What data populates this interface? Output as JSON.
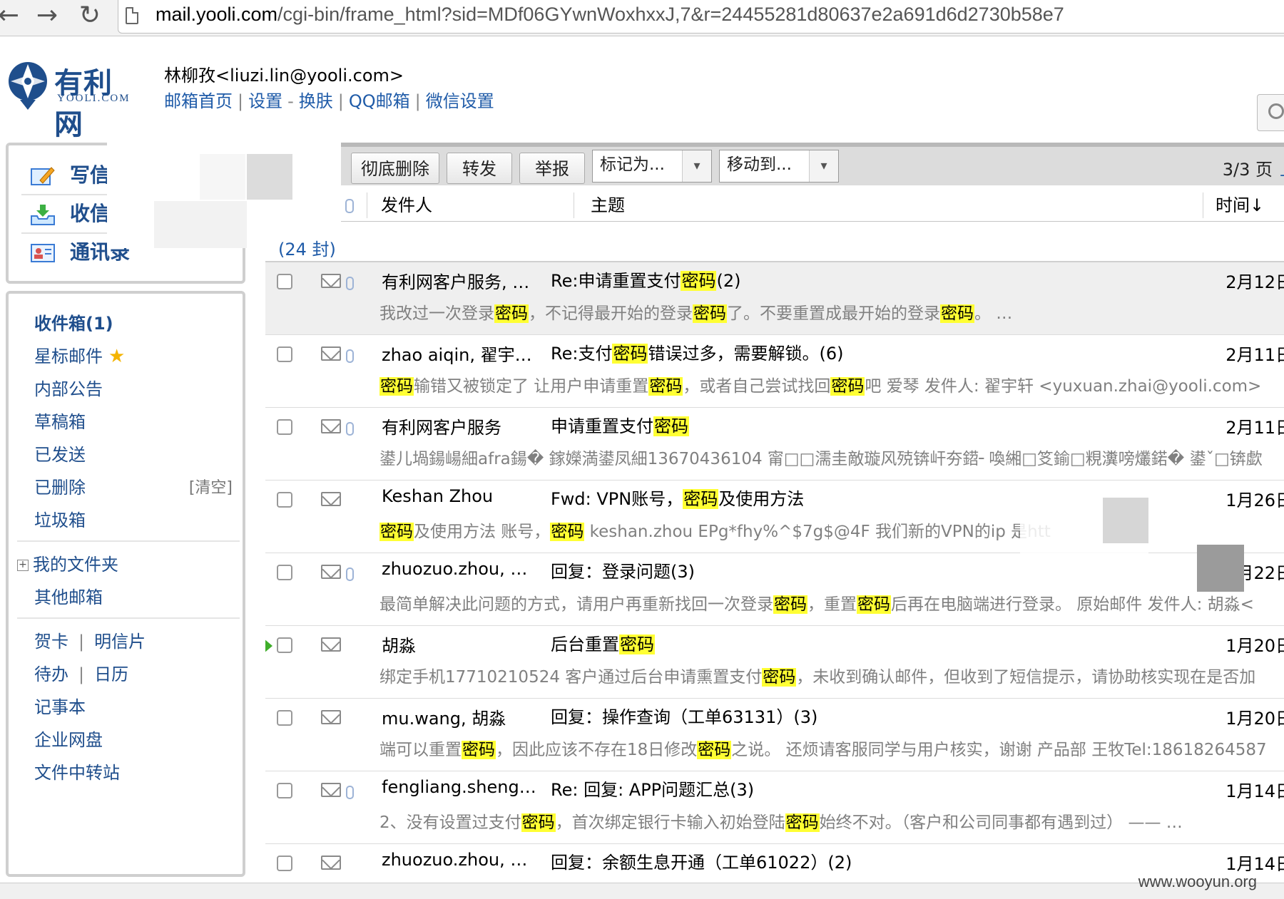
{
  "browser": {
    "nav": {
      "back": "←",
      "forward": "→",
      "reload": "↻"
    },
    "url_host": "mail.yooli.com",
    "url_path": "/cgi-bin/frame_html?sid=MDf06GYwnWoxhxxJ,7&r=24455281d80637e2a691d6d2730b58e7"
  },
  "header": {
    "logo_text": "有利网",
    "logo_sub": "YOOLI.COM",
    "user_email": "林柳孜<liuzi.lin@yooli.com>",
    "links": [
      "邮箱首页",
      "设置",
      "换肤",
      "QQ邮箱",
      "微信设置"
    ],
    "link_seps": [
      "|",
      "-",
      "|",
      "|"
    ]
  },
  "sidebar": {
    "quick": [
      {
        "label": "写信",
        "icon": "compose-icon"
      },
      {
        "label": "收信",
        "icon": "inbox-download-icon"
      },
      {
        "label": "通讯录",
        "icon": "contacts-icon"
      }
    ],
    "folders": {
      "inbox": "收件箱(1)",
      "starred": "星标邮件",
      "internal": "内部公告",
      "drafts": "草稿箱",
      "sent": "已发送",
      "deleted": "已删除",
      "deleted_clear": "[清空]",
      "spam": "垃圾箱",
      "myfolders": "我的文件夹",
      "myfolders_toggle": "+",
      "other": "其他邮箱",
      "greeting": "贺卡",
      "postcard": "明信片",
      "todo": "待办",
      "calendar": "日历",
      "notes": "记事本",
      "disk": "企业网盘",
      "transfer": "文件中转站",
      "sep": "|"
    }
  },
  "toolbar": {
    "buttons": [
      "彻底删除",
      "转发",
      "举报"
    ],
    "mark_as": "标记为...",
    "move_to": "移动到...",
    "pager": "3/3 页",
    "pager_next": "上",
    "dropdown_arrow": "▾"
  },
  "list_header": {
    "sender": "发件人",
    "subject": "主题",
    "time": "时间↓"
  },
  "group_label": "(24 封)",
  "emails": [
    {
      "sender": "有利网客户服务, …",
      "subject": [
        {
          "t": "Re:申请重置支付"
        },
        {
          "t": "密码",
          "h": true
        },
        {
          "t": "(2)"
        }
      ],
      "preview": [
        {
          "t": "我改过一次登录"
        },
        {
          "t": "密码",
          "h": true
        },
        {
          "t": "，不记得最开始的登录"
        },
        {
          "t": "密码",
          "h": true
        },
        {
          "t": "了。不要重置成最开始的登录"
        },
        {
          "t": "密码",
          "h": true
        },
        {
          "t": "。 …"
        }
      ],
      "date": "2月12日",
      "attach": true,
      "selected": true,
      "flag": false
    },
    {
      "sender": "zhao aiqin, 翟宇…",
      "subject": [
        {
          "t": "Re:支付"
        },
        {
          "t": "密码",
          "h": true
        },
        {
          "t": "错误过多，需要解锁。(6)"
        }
      ],
      "preview": [
        {
          "t": "密码",
          "h": true
        },
        {
          "t": "输错又被锁定了 让用户申请重置"
        },
        {
          "t": "密码",
          "h": true
        },
        {
          "t": "，或者自己尝试找回"
        },
        {
          "t": "密码",
          "h": true
        },
        {
          "t": "吧 爱琴 发件人: 翟宇轩 <yuxuan.zhai@yooli.com>"
        }
      ],
      "date": "2月11日",
      "attach": true,
      "selected": false,
      "flag": false
    },
    {
      "sender": "有利网客户服务",
      "subject": [
        {
          "t": "申请重置支付"
        },
        {
          "t": "密码",
          "h": true
        }
      ],
      "preview": [
        {
          "t": "鍙儿堝鍚崵細afra鍚� 鎵嬫満鍙凤細13670436104 甯□□濡圭敵璇风殑锛屽夯鍣╴喚緗□笅鍮□粯瀵嗙爜鍩� 鍙ˇ□锛歔"
        }
      ],
      "date": "2月11日",
      "attach": true,
      "selected": false,
      "flag": false
    },
    {
      "sender": "Keshan Zhou",
      "subject": [
        {
          "t": "Fwd: VPN账号，"
        },
        {
          "t": "密码",
          "h": true
        },
        {
          "t": "及使用方法"
        }
      ],
      "preview": [
        {
          "t": "密码",
          "h": true
        },
        {
          "t": "及使用方法 账号，"
        },
        {
          "t": "密码",
          "h": true
        },
        {
          "t": " keshan.zhou EPg*fhy%^$7g$@4F 我们新的VPN的ip 是htt"
        }
      ],
      "date": "1月26日",
      "attach": false,
      "selected": false,
      "flag": false
    },
    {
      "sender": "zhuozuo.zhou, …",
      "subject": [
        {
          "t": "回复：登录问题(3)"
        }
      ],
      "preview": [
        {
          "t": "最简单解决此问题的方式，请用户再重新找回一次登录"
        },
        {
          "t": "密码",
          "h": true
        },
        {
          "t": "，重置"
        },
        {
          "t": "密码",
          "h": true
        },
        {
          "t": "后再在电脑端进行登录。 原始邮件 发件人: 胡淼<"
        }
      ],
      "date": "1月22日",
      "attach": true,
      "selected": false,
      "flag": false
    },
    {
      "sender": "胡淼",
      "subject": [
        {
          "t": "后台重置"
        },
        {
          "t": "密码",
          "h": true
        }
      ],
      "preview": [
        {
          "t": "绑定手机17710210524 客户通过后台申请熏置支付"
        },
        {
          "t": "密码",
          "h": true
        },
        {
          "t": "，未收到确认邮件，但收到了短信提示，请协助核实现在是否加"
        }
      ],
      "date": "1月20日",
      "attach": false,
      "selected": false,
      "flag": true
    },
    {
      "sender": "mu.wang, 胡淼",
      "subject": [
        {
          "t": "回复：操作查询（工单63131）(3)"
        }
      ],
      "preview": [
        {
          "t": "端可以重置"
        },
        {
          "t": "密码",
          "h": true
        },
        {
          "t": "，因此应该不存在18日修改"
        },
        {
          "t": "密码",
          "h": true
        },
        {
          "t": "之说。 还烦请客服同学与用户核实，谢谢 产品部 王牧Tel:18618264587"
        }
      ],
      "date": "1月20日",
      "attach": false,
      "selected": false,
      "flag": false
    },
    {
      "sender": "fengliang.sheng…",
      "subject": [
        {
          "t": "Re: 回复: APP问题汇总(3)"
        }
      ],
      "preview": [
        {
          "t": "2、没有设置过支付"
        },
        {
          "t": "密码",
          "h": true
        },
        {
          "t": "，首次绑定银行卡输入初始登陆"
        },
        {
          "t": "密码",
          "h": true
        },
        {
          "t": "始终不对。（客户和公司同事都有遇到过） —— …"
        }
      ],
      "date": "1月14日",
      "attach": true,
      "selected": false,
      "flag": false
    },
    {
      "sender": "zhuozuo.zhou, …",
      "subject": [
        {
          "t": "回复：余额生息开通（工单61022）(2)"
        }
      ],
      "preview": [],
      "date": "1月14日",
      "attach": false,
      "selected": false,
      "flag": false
    }
  ],
  "watermark": "www.wooyun.org"
}
